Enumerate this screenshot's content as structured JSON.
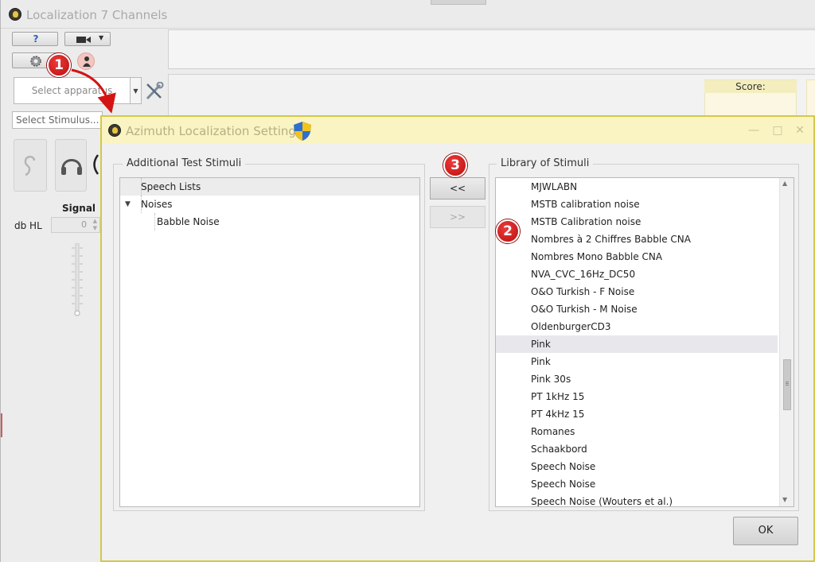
{
  "main_window": {
    "title": "Localization 7 Channels",
    "help_button": "?",
    "select_apparatus_placeholder": "Select apparatus",
    "select_stimulus_placeholder": "Select Stimulus...",
    "signal_label": "Signal",
    "dbhl_label": "db HL",
    "dbhl_value": "0",
    "score_label": "Score:"
  },
  "dialog": {
    "title": "Azimuth Localization Settings",
    "additional_group_title": "Additional Test Stimuli",
    "tree": [
      {
        "label": "Speech Lists",
        "level": 0,
        "expanded": null
      },
      {
        "label": "Noises",
        "level": 0,
        "expanded": true
      },
      {
        "label": "Babble Noise",
        "level": 1,
        "expanded": null
      }
    ],
    "move_left_label": "<<",
    "move_right_label": ">>",
    "library_group_title": "Library of Stimuli",
    "library_items": [
      "MJWLABN",
      "MSTB calibration noise",
      "MSTB Calibration noise",
      "Nombres à 2 Chiffres Babble CNA",
      "Nombres Mono Babble CNA",
      "NVA_CVC_16Hz_DC50",
      "O&O Turkish - F Noise",
      "O&O Turkish - M Noise",
      "OldenburgerCD3",
      "Pink",
      "Pink",
      "Pink 30s",
      "PT 1kHz 15",
      "PT 4kHz 15",
      "Romanes",
      "Schaakbord",
      "Speech Noise",
      "Speech Noise",
      "Speech Noise (Wouters et al.)"
    ],
    "library_selected_index": 9,
    "ok_label": "OK"
  },
  "annotations": {
    "badge_1": "1",
    "badge_2": "2",
    "badge_3": "3"
  },
  "icons": {
    "app": "app-logo-icon",
    "help": "question-icon",
    "camera": "video-camera-icon",
    "settings": "gear-icon",
    "user": "person-icon",
    "tools": "wrench-screwdriver-icon",
    "ear": "ear-icon",
    "headphones": "headphones-icon",
    "speaker": "sound-waves-icon",
    "shield": "uac-shield-icon"
  },
  "colors": {
    "dialog_border": "#d4c84a",
    "dialog_titlebar": "#f9f4c2",
    "annotation_red": "#d41414",
    "selected_row": "#e8e8ec"
  }
}
